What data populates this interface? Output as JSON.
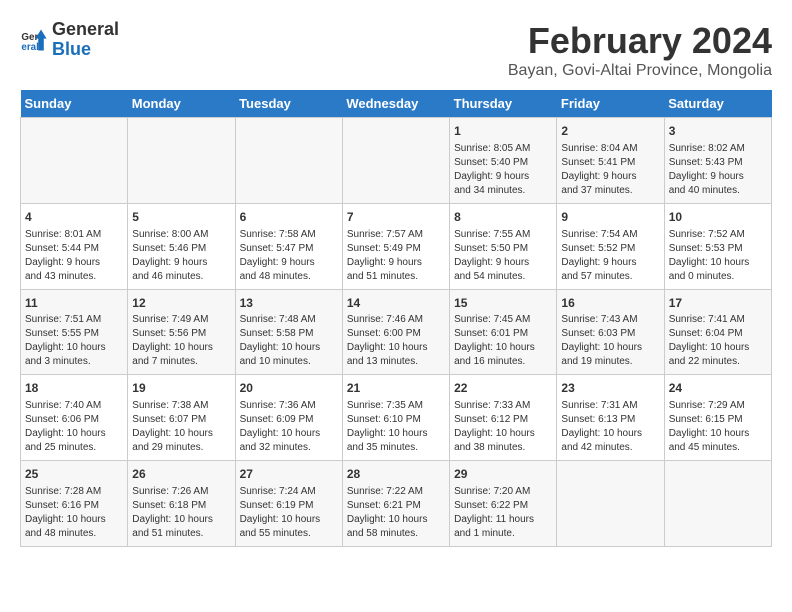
{
  "header": {
    "logo_line1": "General",
    "logo_line2": "Blue",
    "month_title": "February 2024",
    "subtitle": "Bayan, Govi-Altai Province, Mongolia"
  },
  "calendar": {
    "days_of_week": [
      "Sunday",
      "Monday",
      "Tuesday",
      "Wednesday",
      "Thursday",
      "Friday",
      "Saturday"
    ],
    "weeks": [
      [
        {
          "day": "",
          "info": ""
        },
        {
          "day": "",
          "info": ""
        },
        {
          "day": "",
          "info": ""
        },
        {
          "day": "",
          "info": ""
        },
        {
          "day": "1",
          "info": "Sunrise: 8:05 AM\nSunset: 5:40 PM\nDaylight: 9 hours\nand 34 minutes."
        },
        {
          "day": "2",
          "info": "Sunrise: 8:04 AM\nSunset: 5:41 PM\nDaylight: 9 hours\nand 37 minutes."
        },
        {
          "day": "3",
          "info": "Sunrise: 8:02 AM\nSunset: 5:43 PM\nDaylight: 9 hours\nand 40 minutes."
        }
      ],
      [
        {
          "day": "4",
          "info": "Sunrise: 8:01 AM\nSunset: 5:44 PM\nDaylight: 9 hours\nand 43 minutes."
        },
        {
          "day": "5",
          "info": "Sunrise: 8:00 AM\nSunset: 5:46 PM\nDaylight: 9 hours\nand 46 minutes."
        },
        {
          "day": "6",
          "info": "Sunrise: 7:58 AM\nSunset: 5:47 PM\nDaylight: 9 hours\nand 48 minutes."
        },
        {
          "day": "7",
          "info": "Sunrise: 7:57 AM\nSunset: 5:49 PM\nDaylight: 9 hours\nand 51 minutes."
        },
        {
          "day": "8",
          "info": "Sunrise: 7:55 AM\nSunset: 5:50 PM\nDaylight: 9 hours\nand 54 minutes."
        },
        {
          "day": "9",
          "info": "Sunrise: 7:54 AM\nSunset: 5:52 PM\nDaylight: 9 hours\nand 57 minutes."
        },
        {
          "day": "10",
          "info": "Sunrise: 7:52 AM\nSunset: 5:53 PM\nDaylight: 10 hours\nand 0 minutes."
        }
      ],
      [
        {
          "day": "11",
          "info": "Sunrise: 7:51 AM\nSunset: 5:55 PM\nDaylight: 10 hours\nand 3 minutes."
        },
        {
          "day": "12",
          "info": "Sunrise: 7:49 AM\nSunset: 5:56 PM\nDaylight: 10 hours\nand 7 minutes."
        },
        {
          "day": "13",
          "info": "Sunrise: 7:48 AM\nSunset: 5:58 PM\nDaylight: 10 hours\nand 10 minutes."
        },
        {
          "day": "14",
          "info": "Sunrise: 7:46 AM\nSunset: 6:00 PM\nDaylight: 10 hours\nand 13 minutes."
        },
        {
          "day": "15",
          "info": "Sunrise: 7:45 AM\nSunset: 6:01 PM\nDaylight: 10 hours\nand 16 minutes."
        },
        {
          "day": "16",
          "info": "Sunrise: 7:43 AM\nSunset: 6:03 PM\nDaylight: 10 hours\nand 19 minutes."
        },
        {
          "day": "17",
          "info": "Sunrise: 7:41 AM\nSunset: 6:04 PM\nDaylight: 10 hours\nand 22 minutes."
        }
      ],
      [
        {
          "day": "18",
          "info": "Sunrise: 7:40 AM\nSunset: 6:06 PM\nDaylight: 10 hours\nand 25 minutes."
        },
        {
          "day": "19",
          "info": "Sunrise: 7:38 AM\nSunset: 6:07 PM\nDaylight: 10 hours\nand 29 minutes."
        },
        {
          "day": "20",
          "info": "Sunrise: 7:36 AM\nSunset: 6:09 PM\nDaylight: 10 hours\nand 32 minutes."
        },
        {
          "day": "21",
          "info": "Sunrise: 7:35 AM\nSunset: 6:10 PM\nDaylight: 10 hours\nand 35 minutes."
        },
        {
          "day": "22",
          "info": "Sunrise: 7:33 AM\nSunset: 6:12 PM\nDaylight: 10 hours\nand 38 minutes."
        },
        {
          "day": "23",
          "info": "Sunrise: 7:31 AM\nSunset: 6:13 PM\nDaylight: 10 hours\nand 42 minutes."
        },
        {
          "day": "24",
          "info": "Sunrise: 7:29 AM\nSunset: 6:15 PM\nDaylight: 10 hours\nand 45 minutes."
        }
      ],
      [
        {
          "day": "25",
          "info": "Sunrise: 7:28 AM\nSunset: 6:16 PM\nDaylight: 10 hours\nand 48 minutes."
        },
        {
          "day": "26",
          "info": "Sunrise: 7:26 AM\nSunset: 6:18 PM\nDaylight: 10 hours\nand 51 minutes."
        },
        {
          "day": "27",
          "info": "Sunrise: 7:24 AM\nSunset: 6:19 PM\nDaylight: 10 hours\nand 55 minutes."
        },
        {
          "day": "28",
          "info": "Sunrise: 7:22 AM\nSunset: 6:21 PM\nDaylight: 10 hours\nand 58 minutes."
        },
        {
          "day": "29",
          "info": "Sunrise: 7:20 AM\nSunset: 6:22 PM\nDaylight: 11 hours\nand 1 minute."
        },
        {
          "day": "",
          "info": ""
        },
        {
          "day": "",
          "info": ""
        }
      ]
    ]
  }
}
